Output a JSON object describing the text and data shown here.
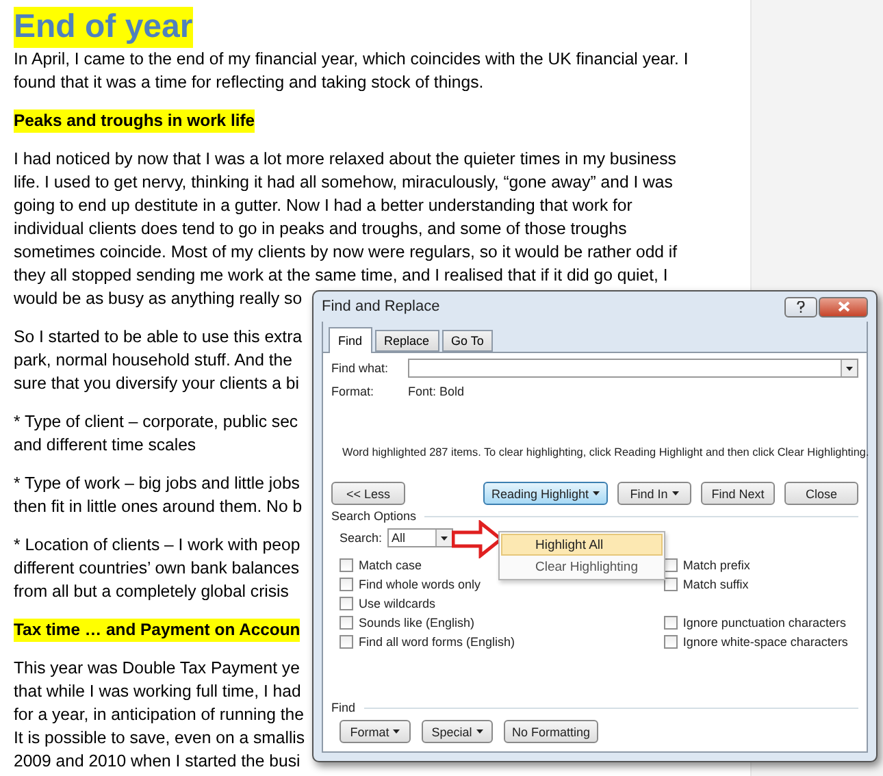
{
  "document": {
    "blocks": [
      {
        "kind": "title",
        "lines": [
          "End of year"
        ]
      },
      {
        "kind": "para",
        "lines": [
          "In April, I came to the end of my financial year, which coincides with the UK financial year. I",
          "found that it was a time for reflecting and taking stock of things."
        ]
      },
      {
        "kind": "heading",
        "lines": [
          "Peaks and troughs in work life"
        ]
      },
      {
        "kind": "para",
        "lines": [
          "I had noticed by now that I was a lot more relaxed about the quieter times in my business",
          "life. I used to get nervy, thinking it had all somehow, miraculously, “gone away” and I was",
          "going to end up destitute in a gutter. Now I had a better understanding that work for",
          "individual clients does tend to go in peaks and troughs, and some of those troughs",
          "sometimes coincide. Most of my clients by now were regulars, so it would be rather odd if",
          "they all stopped sending me work at the same time, and I realised that if it did go quiet, I",
          "would be as busy as anything really so"
        ]
      },
      {
        "kind": "para",
        "lines": [
          "So I started to be able to use this extra",
          "park, normal household stuff. And the",
          "sure that you diversify your clients a bi"
        ]
      },
      {
        "kind": "para",
        "lines": [
          "* Type of client – corporate, public sec",
          "and different time scales"
        ]
      },
      {
        "kind": "para",
        "lines": [
          "* Type of work – big jobs and little jobs",
          "then fit in little ones around them. No b"
        ]
      },
      {
        "kind": "para",
        "lines": [
          "* Location of clients – I work with peop",
          "different countries’ own bank balances",
          "from all but a completely global crisis"
        ]
      },
      {
        "kind": "heading",
        "lines": [
          "Tax time … and Payment on Accoun"
        ]
      },
      {
        "kind": "para",
        "lines": [
          "This year was Double Tax Payment ye",
          "that while I was working full time, I had",
          "for a year, in anticipation of running the",
          "It is possible to save, even on a smallis",
          "2009 and 2010 when I started the busi"
        ]
      }
    ]
  },
  "dialog": {
    "title": "Find and Replace",
    "tabs": [
      {
        "label": "Find",
        "selected": true
      },
      {
        "label": "Replace",
        "selected": false
      },
      {
        "label": "Go To",
        "selected": false
      }
    ],
    "find_what": {
      "label": "Find what:"
    },
    "format": {
      "label": "Format:",
      "value": "Font: Bold"
    },
    "message": "Word highlighted 287 items. To clear highlighting, click Reading Highlight and then click Clear Highlighting.",
    "buttons": [
      {
        "label": "<< Less",
        "menu": false,
        "active": false,
        "kind": "left"
      },
      {
        "label": "Reading Highlight",
        "menu": true,
        "active": true,
        "kind": "right"
      },
      {
        "label": "Find In",
        "menu": true,
        "active": false,
        "kind": "right"
      },
      {
        "label": "Find Next",
        "menu": false,
        "active": false,
        "kind": "right"
      },
      {
        "label": "Close",
        "menu": false,
        "active": false,
        "kind": "right"
      }
    ],
    "menu": [
      {
        "label": "Highlight All",
        "selected": true
      },
      {
        "label": "Clear Highlighting",
        "selected": false
      }
    ],
    "search_options": {
      "title": "Search Options",
      "search_label": "Search:",
      "search_value": "All",
      "left": [
        {
          "label": "Match case",
          "checked": false
        },
        {
          "label": "Find whole words only",
          "checked": false
        },
        {
          "label": "Use wildcards",
          "checked": false
        },
        {
          "label": "Sounds like (English)",
          "checked": false
        },
        {
          "label": "Find all word forms (English)",
          "checked": false
        }
      ],
      "right": [
        [
          {
            "label": "Match prefix",
            "checked": false
          },
          {
            "label": "Match suffix",
            "checked": false
          }
        ],
        [
          {
            "label": "Ignore punctuation characters",
            "checked": false
          },
          {
            "label": "Ignore white-space characters",
            "checked": false
          }
        ]
      ]
    },
    "find_group": {
      "title": "Find",
      "buttons": [
        {
          "label": "Format",
          "menu": true
        },
        {
          "label": "Special",
          "menu": true
        },
        {
          "label": "No Formatting",
          "menu": false
        }
      ]
    }
  }
}
